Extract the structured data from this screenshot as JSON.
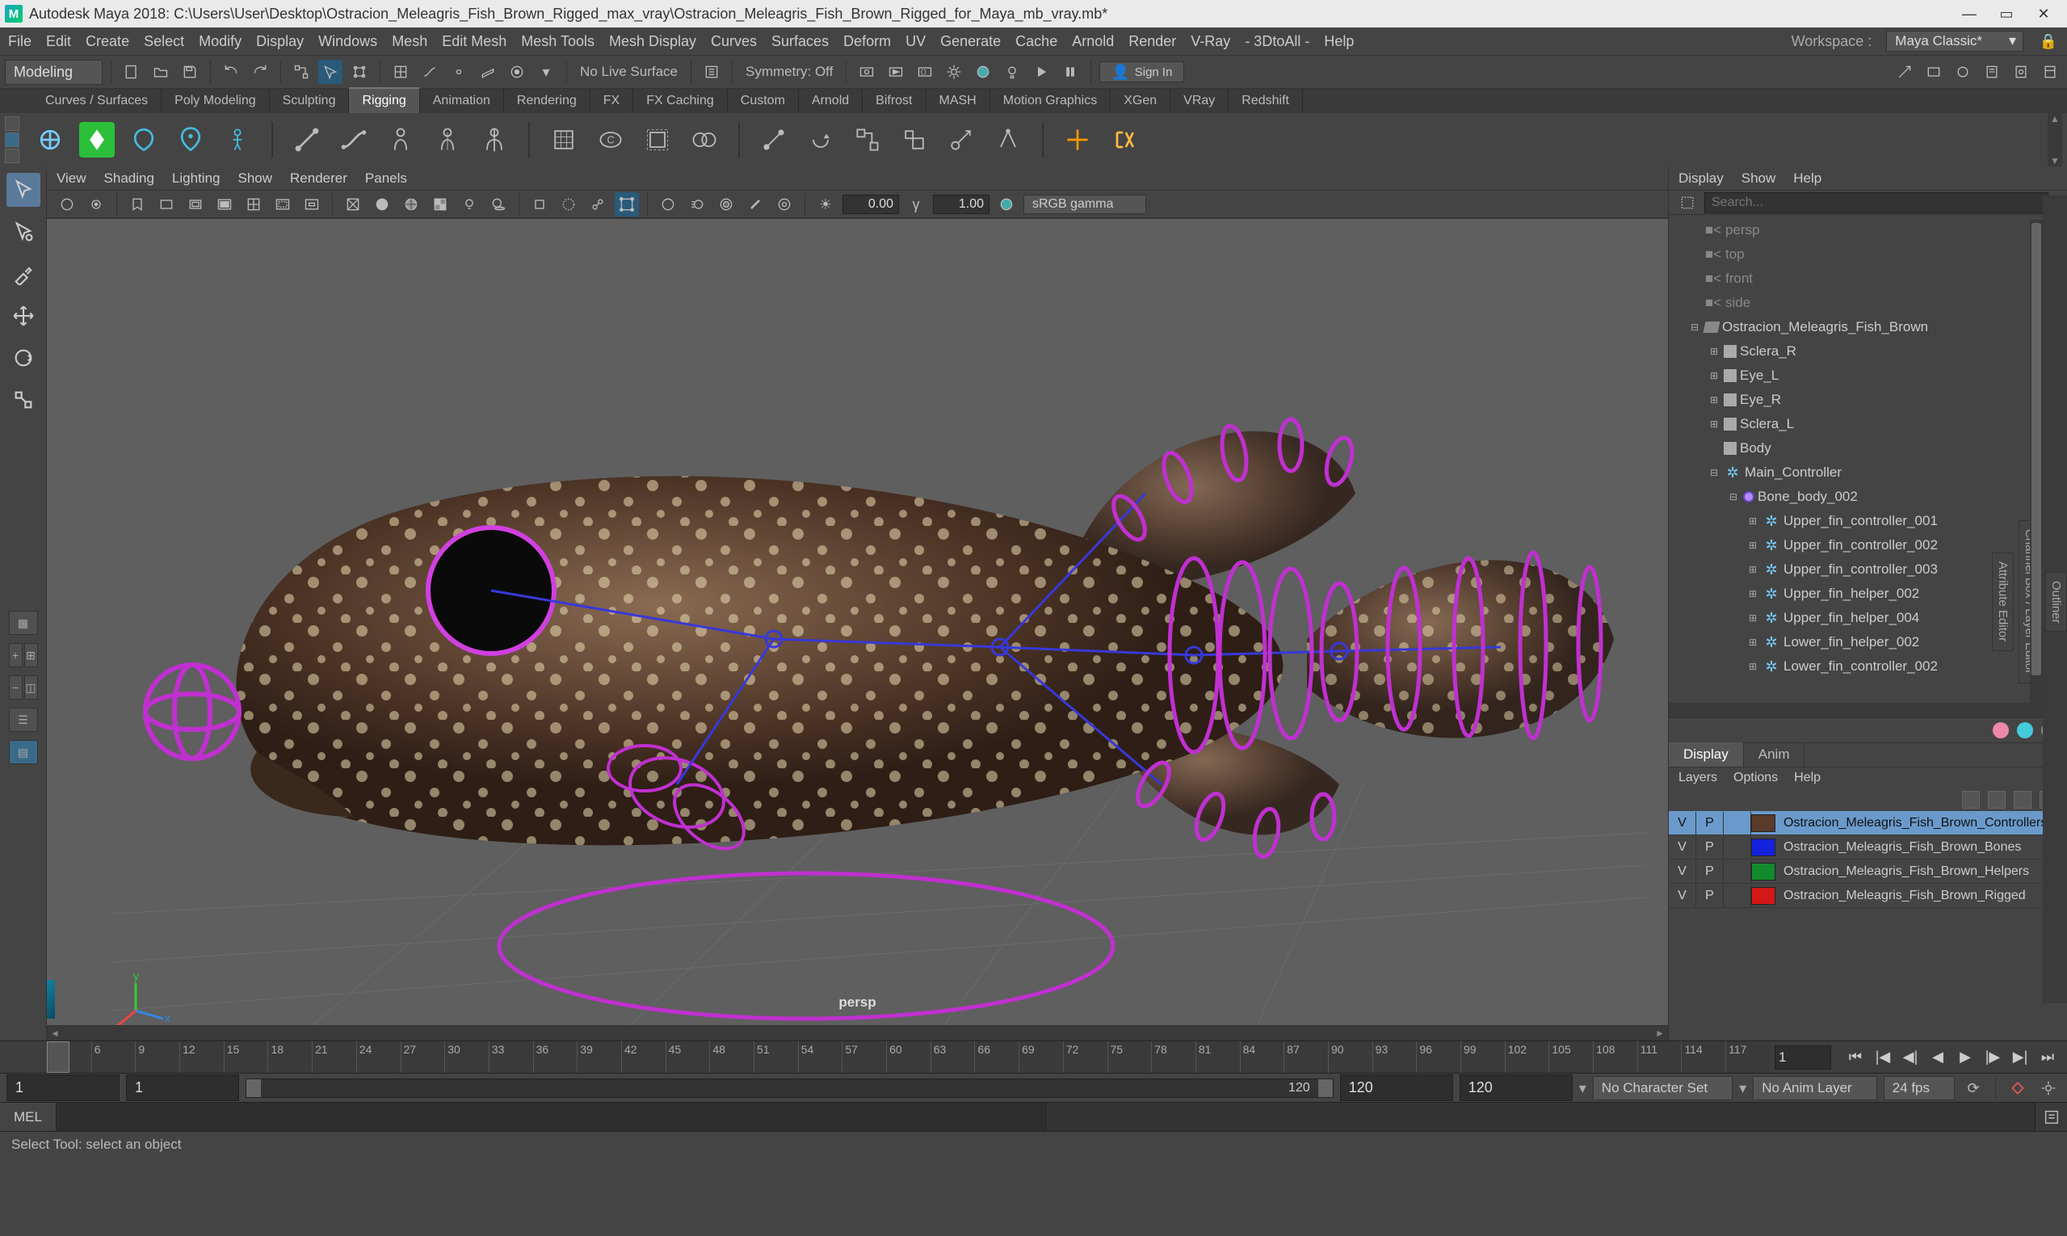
{
  "title": "Autodesk Maya 2018: C:\\Users\\User\\Desktop\\Ostracion_Meleagris_Fish_Brown_Rigged_max_vray\\Ostracion_Meleagris_Fish_Brown_Rigged_for_Maya_mb_vray.mb*",
  "main_menu": [
    "File",
    "Edit",
    "Create",
    "Select",
    "Modify",
    "Display",
    "Windows",
    "Mesh",
    "Edit Mesh",
    "Mesh Tools",
    "Mesh Display",
    "Curves",
    "Surfaces",
    "Deform",
    "UV",
    "Generate",
    "Cache",
    "Arnold",
    "Render",
    "V-Ray",
    "- 3DtoAll -",
    "Help"
  ],
  "workspace_label": "Workspace :",
  "workspace_value": "Maya Classic*",
  "menu_set": "Modeling",
  "no_live_surface": "No Live Surface",
  "symmetry": "Symmetry: Off",
  "sign_in": "Sign In",
  "shelf_tabs": [
    "Curves / Surfaces",
    "Poly Modeling",
    "Sculpting",
    "Rigging",
    "Animation",
    "Rendering",
    "FX",
    "FX Caching",
    "Custom",
    "Arnold",
    "Bifrost",
    "MASH",
    "Motion Graphics",
    "XGen",
    "VRay",
    "Redshift"
  ],
  "shelf_active": "Rigging",
  "viewport_menu": [
    "View",
    "Shading",
    "Lighting",
    "Show",
    "Renderer",
    "Panels"
  ],
  "vp_exposure": "0.00",
  "vp_gamma": "1.00",
  "vp_color_mgmt": "sRGB gamma",
  "persp": "persp",
  "outliner_menu": [
    "Display",
    "Show",
    "Help"
  ],
  "search_placeholder": "Search...",
  "tree": [
    {
      "depth": 1,
      "exp": "",
      "icon": "cam",
      "label": "persp",
      "dim": true
    },
    {
      "depth": 1,
      "exp": "",
      "icon": "cam",
      "label": "top",
      "dim": true
    },
    {
      "depth": 1,
      "exp": "",
      "icon": "cam",
      "label": "front",
      "dim": true
    },
    {
      "depth": 1,
      "exp": "",
      "icon": "cam",
      "label": "side",
      "dim": true
    },
    {
      "depth": 1,
      "exp": "−",
      "icon": "grp",
      "label": "Ostracion_Meleagris_Fish_Brown"
    },
    {
      "depth": 2,
      "exp": "+",
      "icon": "mesh",
      "label": "Sclera_R"
    },
    {
      "depth": 2,
      "exp": "+",
      "icon": "mesh",
      "label": "Eye_L"
    },
    {
      "depth": 2,
      "exp": "+",
      "icon": "mesh",
      "label": "Eye_R"
    },
    {
      "depth": 2,
      "exp": "+",
      "icon": "mesh",
      "label": "Sclera_L"
    },
    {
      "depth": 2,
      "exp": "",
      "icon": "mesh",
      "label": "Body"
    },
    {
      "depth": 2,
      "exp": "−",
      "icon": "ctrl",
      "label": "Main_Controller"
    },
    {
      "depth": 3,
      "exp": "−",
      "icon": "joint",
      "label": "Bone_body_002"
    },
    {
      "depth": 4,
      "exp": "+",
      "icon": "ctrl",
      "label": "Upper_fin_controller_001"
    },
    {
      "depth": 4,
      "exp": "+",
      "icon": "ctrl",
      "label": "Upper_fin_controller_002"
    },
    {
      "depth": 4,
      "exp": "+",
      "icon": "ctrl",
      "label": "Upper_fin_controller_003"
    },
    {
      "depth": 4,
      "exp": "+",
      "icon": "ctrl",
      "label": "Upper_fin_helper_002"
    },
    {
      "depth": 4,
      "exp": "+",
      "icon": "ctrl",
      "label": "Upper_fin_helper_004"
    },
    {
      "depth": 4,
      "exp": "+",
      "icon": "ctrl",
      "label": "Lower_fin_helper_002"
    },
    {
      "depth": 4,
      "exp": "+",
      "icon": "ctrl",
      "label": "Lower_fin_controller_002"
    }
  ],
  "layer_tabs": [
    "Display",
    "Anim"
  ],
  "layer_menu": [
    "Layers",
    "Options",
    "Help"
  ],
  "layers": [
    {
      "v": "V",
      "p": "P",
      "color": "#5a3a2a",
      "name": "Ostracion_Meleagris_Fish_Brown_Controllers",
      "sel": true
    },
    {
      "v": "V",
      "p": "P",
      "color": "#1522dd",
      "name": "Ostracion_Meleagris_Fish_Brown_Bones",
      "sel": false
    },
    {
      "v": "V",
      "p": "P",
      "color": "#138a2c",
      "name": "Ostracion_Meleagris_Fish_Brown_Helpers",
      "sel": false
    },
    {
      "v": "V",
      "p": "P",
      "color": "#d41717",
      "name": "Ostracion_Meleagris_Fish_Brown_Rigged",
      "sel": false
    }
  ],
  "time_ticks": [
    "3",
    "6",
    "9",
    "12",
    "15",
    "18",
    "21",
    "24",
    "27",
    "30",
    "33",
    "36",
    "39",
    "42",
    "45",
    "48",
    "51",
    "54",
    "57",
    "60",
    "63",
    "66",
    "69",
    "72",
    "75",
    "78",
    "81",
    "84",
    "87",
    "90",
    "93",
    "96",
    "99",
    "102",
    "105",
    "108",
    "111",
    "114",
    "117"
  ],
  "time_current": "1",
  "range_start_outer": "1",
  "range_start": "1",
  "range_end": "120",
  "range_end_outer": "120",
  "char_set": "No Character Set",
  "anim_layer": "No Anim Layer",
  "fps": "24 fps",
  "cmd_lang": "MEL",
  "help_line": "Select Tool: select an object",
  "side_tabs": [
    "Outliner",
    "Channel Box / Layer Editor",
    "Attribute Editor"
  ]
}
